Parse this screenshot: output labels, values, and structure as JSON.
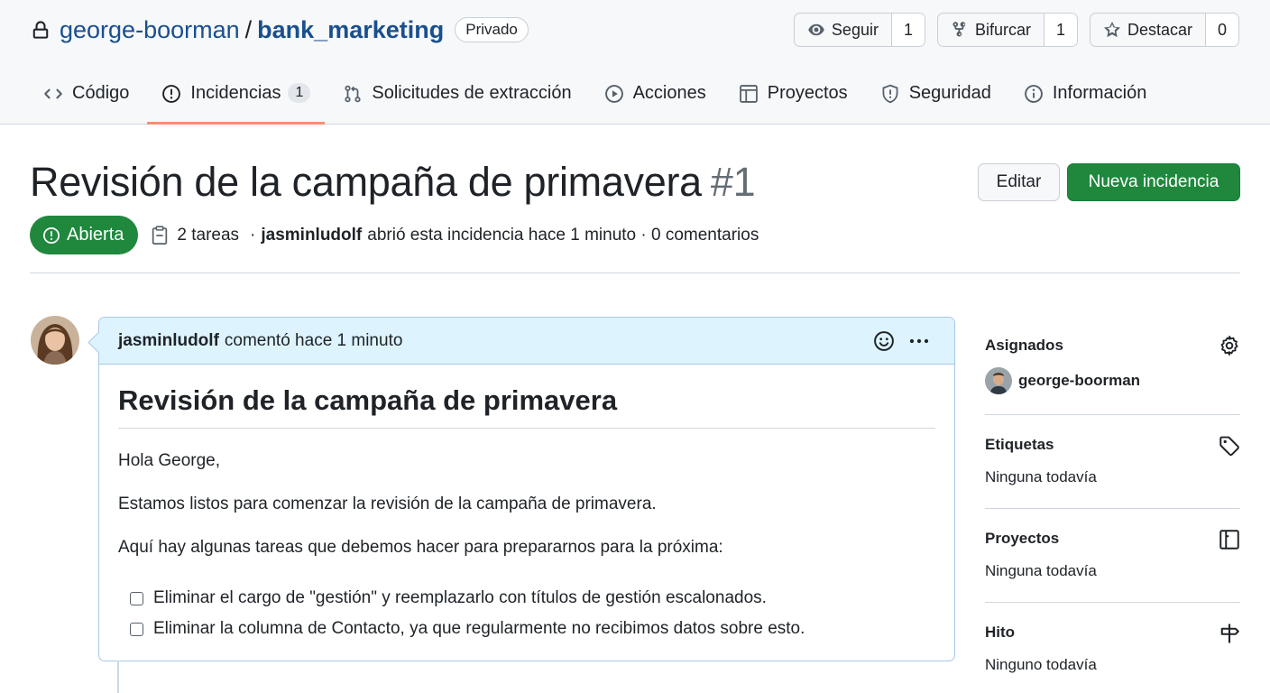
{
  "repo": {
    "owner": "george-boorman",
    "separator": "/",
    "name": "bank_marketing",
    "visibility": "Privado",
    "actions": [
      {
        "label": "Seguir",
        "count": "1",
        "icon": "eye-icon"
      },
      {
        "label": "Bifurcar",
        "count": "1",
        "icon": "fork-icon"
      },
      {
        "label": "Destacar",
        "count": "0",
        "icon": "star-icon"
      }
    ]
  },
  "tabs": [
    {
      "label": "Código",
      "icon": "code-icon"
    },
    {
      "label": "Incidencias",
      "icon": "issue-icon",
      "counter": "1",
      "active": true
    },
    {
      "label": "Solicitudes de extracción",
      "icon": "pull-request-icon"
    },
    {
      "label": "Acciones",
      "icon": "play-icon"
    },
    {
      "label": "Proyectos",
      "icon": "table-icon"
    },
    {
      "label": "Seguridad",
      "icon": "shield-icon"
    },
    {
      "label": "Información",
      "icon": "info-icon"
    }
  ],
  "issue": {
    "title": "Revisión de la campaña de primavera",
    "number": "#1",
    "edit_label": "Editar",
    "new_label": "Nueva incidencia",
    "state": "Abierta",
    "tasks": "2 tareas",
    "meta_sep": "·",
    "author": "jasminludolf",
    "meta_rest": "abrió esta incidencia hace 1 minuto · 0 comentarios"
  },
  "comment": {
    "author": "jasminludolf",
    "action": "comentó hace 1 minuto",
    "heading": "Revisión de la campaña de primavera",
    "paragraphs": [
      "Hola George,",
      "Estamos listos para comenzar la revisión de la campaña de primavera.",
      "Aquí hay algunas tareas que debemos hacer para prepararnos para la próxima:"
    ],
    "tasks": [
      "Eliminar el cargo de \"gestión\" y reemplazarlo con títulos de gestión escalonados.",
      "Eliminar la columna de Contacto, ya que regularmente no recibimos datos sobre esto."
    ]
  },
  "sidebar": {
    "assignees": {
      "title": "Asignados",
      "user": "george-boorman"
    },
    "labels": {
      "title": "Etiquetas",
      "value": "Ninguna todavía"
    },
    "projects": {
      "title": "Proyectos",
      "value": "Ninguna todavía"
    },
    "milestone": {
      "title": "Hito",
      "value": "Ninguno todavía"
    }
  },
  "colors": {
    "accent_green": "#1f883d",
    "link_blue": "#1a4f8f",
    "tab_underline": "#fd8c73",
    "comment_header": "#ddf4ff"
  }
}
